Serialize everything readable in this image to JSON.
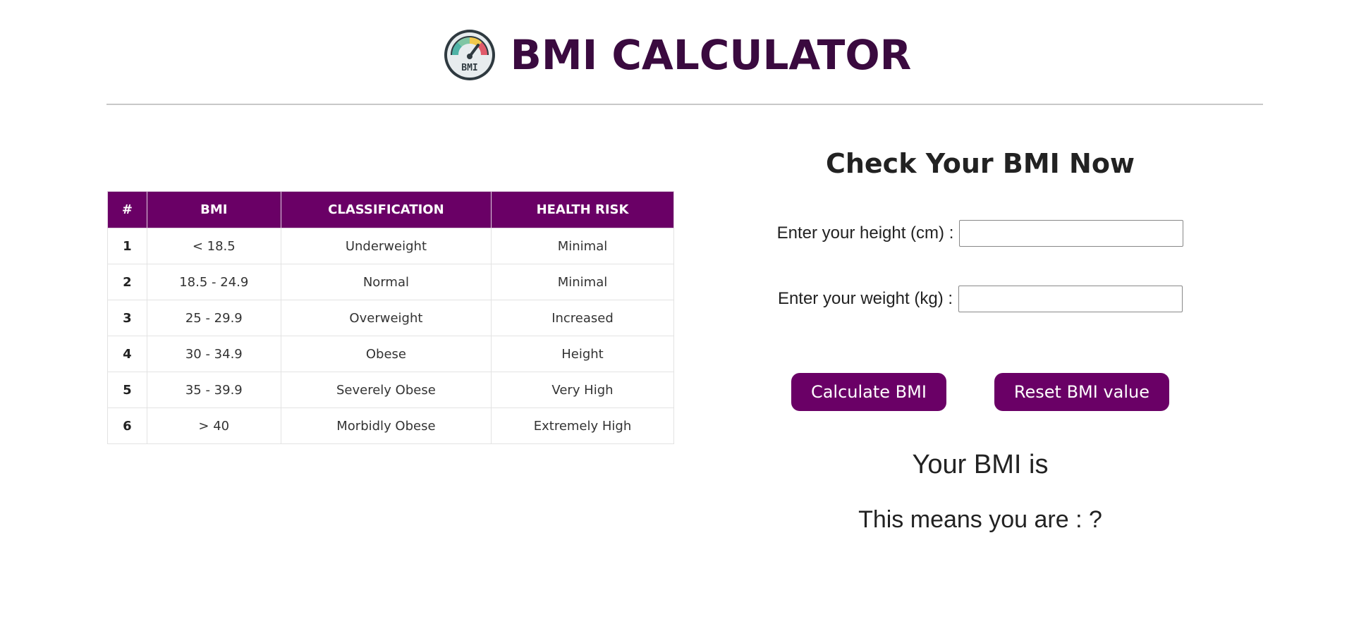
{
  "header": {
    "title": "BMI CALCULATOR",
    "logo_text": "BMI"
  },
  "table": {
    "columns": [
      "#",
      "BMI",
      "CLASSIFICATION",
      "HEALTH RISK"
    ],
    "rows": [
      {
        "num": "1",
        "bmi": "< 18.5",
        "classification": "Underweight",
        "risk": "Minimal"
      },
      {
        "num": "2",
        "bmi": "18.5 - 24.9",
        "classification": "Normal",
        "risk": "Minimal"
      },
      {
        "num": "3",
        "bmi": "25 - 29.9",
        "classification": "Overweight",
        "risk": "Increased"
      },
      {
        "num": "4",
        "bmi": "30 - 34.9",
        "classification": "Obese",
        "risk": "Height"
      },
      {
        "num": "5",
        "bmi": "35 - 39.9",
        "classification": "Severely Obese",
        "risk": "Very High"
      },
      {
        "num": "6",
        "bmi": "> 40",
        "classification": "Morbidly Obese",
        "risk": "Extremely High"
      }
    ]
  },
  "calculator": {
    "title": "Check Your BMI Now",
    "height_label": "Enter your height (cm) :",
    "height_value": "",
    "weight_label": "Enter your weight (kg) :",
    "weight_value": "",
    "calculate_label": "Calculate BMI",
    "reset_label": "Reset BMI value",
    "result_text": "Your BMI is",
    "meaning_text": "This means you are : ?"
  },
  "colors": {
    "accent": "#6a0066",
    "title": "#3a0a3f"
  },
  "icons": {
    "logo": "bmi-gauge-icon"
  }
}
